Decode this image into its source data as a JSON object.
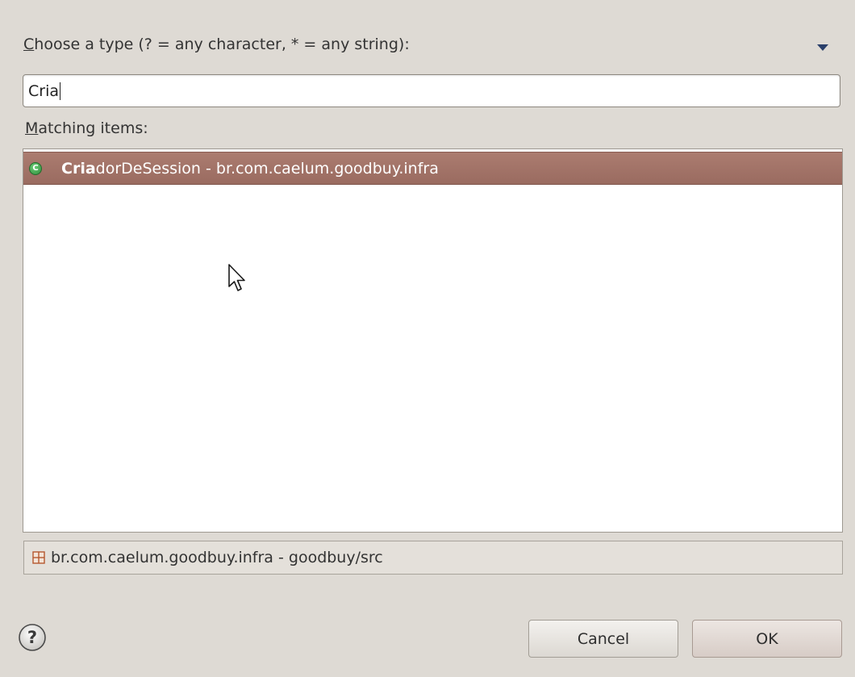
{
  "dialog": {
    "prompt": {
      "mnemonic": "C",
      "rest": "hoose a type (? = any character, * = any string):"
    },
    "filter": {
      "value": "Cria"
    },
    "matching": {
      "mnemonic": "M",
      "rest": "atching items:"
    },
    "results": [
      {
        "icon": "class-icon",
        "icon_glyph": "C",
        "match": "Cria",
        "rest": "dorDeSession",
        "separator": " - ",
        "package": "br.com.caelum.goodbuy.infra",
        "selected": true
      }
    ],
    "details": {
      "icon": "package-icon",
      "text": "br.com.caelum.goodbuy.infra - goodbuy/src"
    },
    "buttons": {
      "cancel": "Cancel",
      "ok": "OK"
    }
  },
  "colors": {
    "background": "#dedad4",
    "selection": "#a37568",
    "menu_arrow": "#2a3f6a",
    "class_icon": "#3c9a48",
    "package_icon": "#b5572f"
  }
}
